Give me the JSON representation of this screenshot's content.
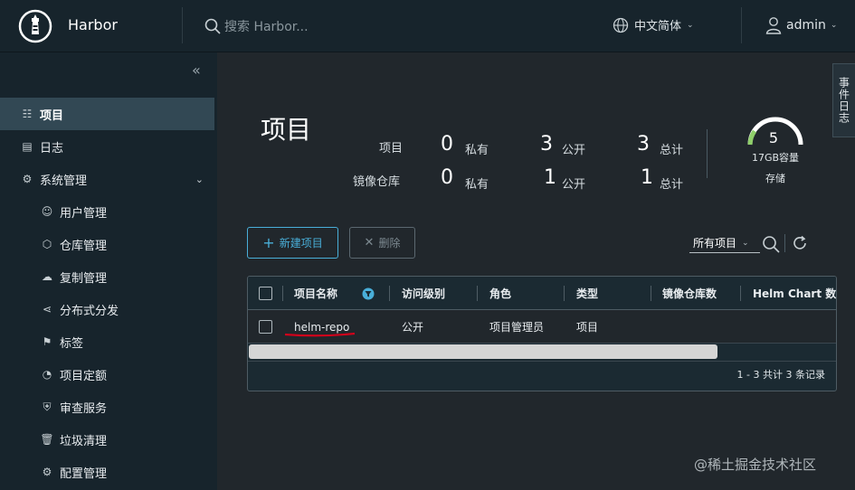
{
  "header": {
    "app_title": "Harbor",
    "search_placeholder": "搜索 Harbor...",
    "language": "中文简体",
    "user": "admin"
  },
  "event_tab": "事件日志",
  "sidebar": {
    "items": [
      {
        "label": "项目",
        "icon": "projects-icon",
        "active": true
      },
      {
        "label": "日志",
        "icon": "logs-icon"
      },
      {
        "label": "系统管理",
        "icon": "admin-icon",
        "expanded": true
      },
      {
        "label": "用户管理",
        "icon": "users-icon"
      },
      {
        "label": "仓库管理",
        "icon": "cube-icon"
      },
      {
        "label": "复制管理",
        "icon": "cloud-icon"
      },
      {
        "label": "分布式分发",
        "icon": "share-icon"
      },
      {
        "label": "标签",
        "icon": "tag-icon"
      },
      {
        "label": "项目定额",
        "icon": "gauge-icon"
      },
      {
        "label": "审查服务",
        "icon": "shield-icon"
      },
      {
        "label": "垃圾清理",
        "icon": "trash-icon"
      },
      {
        "label": "配置管理",
        "icon": "gear-icon"
      }
    ]
  },
  "main": {
    "title": "项目",
    "stats": {
      "row1_label": "项目",
      "row2_label": "镜像仓库",
      "private_label": "私有",
      "public_label": "公开",
      "total_label": "总计",
      "projects_private": "0",
      "projects_public": "3",
      "projects_total": "3",
      "repos_private": "0",
      "repos_public": "1",
      "repos_total": "1"
    },
    "storage": {
      "value": "5",
      "capacity": "17GB容量",
      "label": "存储"
    },
    "toolbar": {
      "new_project": "新建项目",
      "delete": "删除",
      "filter_label": "所有项目"
    },
    "table": {
      "columns": [
        "项目名称",
        "访问级别",
        "角色",
        "类型",
        "镜像仓库数",
        "Helm Chart 数目"
      ],
      "rows": [
        {
          "name": "helm-repo",
          "access": "公开",
          "role": "项目管理员",
          "type": "项目",
          "repos": "",
          "charts": ""
        }
      ],
      "footer": "1 - 3 共计 3 条记录"
    }
  },
  "watermark": "@稀土掘金技术社区",
  "colors": {
    "accent": "#49afd9",
    "header_bg": "#17242c",
    "body_bg": "#21272c",
    "active_nav": "#324854",
    "gauge_green": "#8fcf6a",
    "annotation_red": "#d0021b"
  }
}
